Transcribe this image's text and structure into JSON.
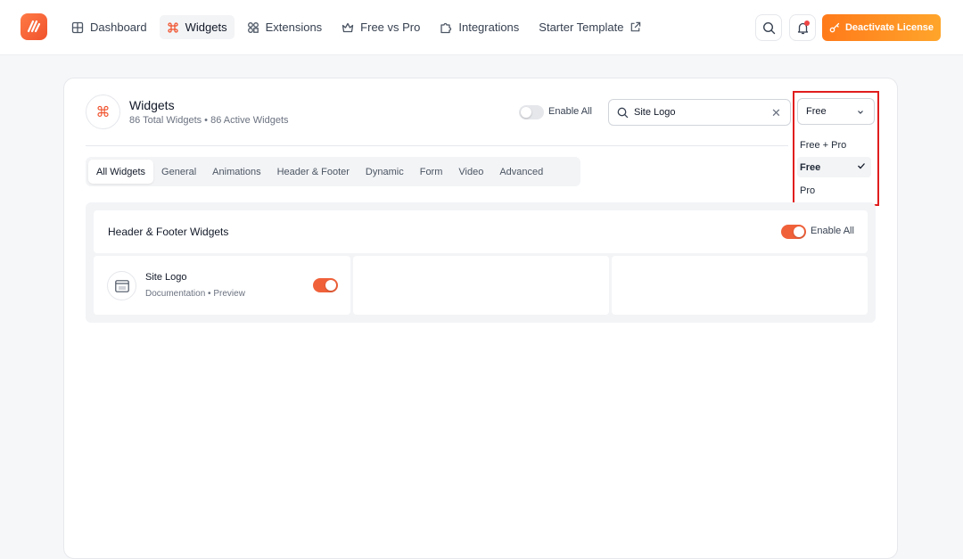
{
  "nav": {
    "items": [
      {
        "label": "Dashboard",
        "icon": "grid-icon"
      },
      {
        "label": "Widgets",
        "icon": "command-icon",
        "active": true
      },
      {
        "label": "Extensions",
        "icon": "shapes-icon"
      },
      {
        "label": "Free vs Pro",
        "icon": "crown-icon"
      },
      {
        "label": "Integrations",
        "icon": "puzzle-icon"
      },
      {
        "label": "Starter Template",
        "icon": "external-link-icon"
      }
    ],
    "deactivate_label": "Deactivate License"
  },
  "header": {
    "title": "Widgets",
    "subtitle": "86 Total Widgets • 86 Active Widgets",
    "enable_all_label": "Enable All",
    "search_value": "Site Logo",
    "filter_value": "Free"
  },
  "filter_dropdown": {
    "options": [
      "Free + Pro",
      "Free",
      "Pro"
    ],
    "selected": "Free"
  },
  "tabs": [
    "All Widgets",
    "General",
    "Animations",
    "Header & Footer",
    "Dynamic",
    "Form",
    "Video",
    "Advanced"
  ],
  "section": {
    "title": "Header & Footer Widgets",
    "enable_all_label": "Enable All",
    "cards": [
      {
        "title": "Site Logo",
        "documentation": "Documentation",
        "separator": "•",
        "preview": "Preview",
        "enabled": true
      }
    ]
  },
  "colors": {
    "accent": "#f0613a",
    "license_button": "#ff8c1f",
    "highlight": "#e11d1d"
  }
}
